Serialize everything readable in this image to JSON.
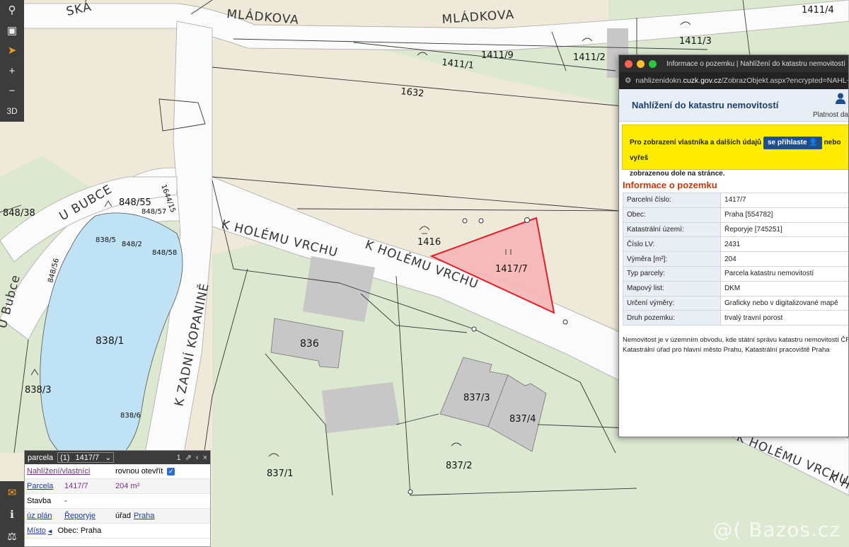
{
  "toolbar": {
    "search_icon": "magnifier",
    "map_icon": "map-fold",
    "locate_icon": "navigation-arrow",
    "zoom_in": "+",
    "zoom_out": "−",
    "view_3d": "3D"
  },
  "bottom_tools": {
    "comment_icon": "speech-bubble",
    "info_icon": "info-i",
    "ruler_icon": "ruler-marker"
  },
  "map": {
    "streets": {
      "mladkova_left": "MLÁDKOVA",
      "mladkova_right": "MLÁDKOVA",
      "u_bubce_top": "U BUBCE",
      "u_bubce_left": "U Bubce",
      "k_holemu_left": "K HOLÉMU VRCHU",
      "k_holemu_mid": "K HOLÉMU VRCHU",
      "k_holemu_bottom": "K HOLÉMU VRCHU",
      "k_ho_edge": "K Ho",
      "k_zadni": "K ZADNÍ KOPANINĚ",
      "s_edge": "SKÁ"
    },
    "parcels": {
      "p1411_4": "1411/4",
      "p1411_3": "1411/3",
      "p1411_9": "1411/9",
      "p1411_2": "1411/2",
      "p1411_1": "1411/1",
      "p1632": "1632",
      "p848_38": "848/38",
      "p848_55": "848/55",
      "p848_57": "848/57",
      "p1644_15": "1644/15",
      "p838_5": "838/5",
      "p848_2": "848/2",
      "p848_58": "848/58",
      "p848_56": "848/56",
      "p838_1": "838/1",
      "p838_3": "838/3",
      "p838_6": "838/6",
      "p1416": "1416",
      "p1417_7": "1417/7",
      "p836": "836",
      "p837_3": "837/3",
      "p837_4": "837/4",
      "p837_2": "837/2",
      "p837_1": "837/1"
    },
    "colors": {
      "road": "#fbfbfb",
      "land": "#efe9d9",
      "green": "#dce8d0",
      "water": "#bfe2f4",
      "building": "#c7c7c7",
      "selected_fill": "#f5b5b5",
      "selected_stroke": "#e0202a"
    }
  },
  "parcel_panel": {
    "title": "parcela",
    "index": "(1)",
    "selected": "1417/7",
    "count": "1",
    "rows": {
      "r1_label": "Nahlížení/vlastníci",
      "r1_value": "rovnou otevřít",
      "r2_label": "Parcela",
      "r2_number": "1417/7",
      "r2_area": "204 m²",
      "r3_label": "Stavba",
      "r3_value": "-",
      "r4_label": "úz plán",
      "r4_value": "Řeporyje",
      "r4_office": "úřad",
      "r4_office_link": "Praha",
      "r5_label": "Místo",
      "r5_arrow": "◂",
      "r5_value": "Obec: Praha"
    }
  },
  "popup": {
    "window_title": "Informace o pozemku | Nahlížení do katastru nemovitostí",
    "url_prefix": "nahlizenidokn.",
    "url_domain": "cuzk.gov.cz",
    "url_rest": "/ZobrazObjekt.aspx?encrypted=NAHL~s",
    "site_title": "Nahlížení do katastru nemovitostí",
    "platnost": "Platnost da",
    "banner_text1": "Pro zobrazení vlastníka a dalších údajů",
    "login_button": "se přihlaste",
    "banner_text2": "nebo vyřeš",
    "banner_text3": "zobrazenou dole na stránce.",
    "section_title": "Informace o pozemku",
    "rows": [
      {
        "k": "Parcelní číslo:",
        "v": "1417/7"
      },
      {
        "k": "Obec:",
        "v": "Praha [554782]"
      },
      {
        "k": "Katastrální území:",
        "v": "Řeporyje [745251]"
      },
      {
        "k": "Číslo LV:",
        "v": "2431"
      },
      {
        "k": "Výměra [m²]:",
        "v": "204"
      },
      {
        "k": "Typ parcely:",
        "v": "Parcela katastru nemovitostí"
      },
      {
        "k": "Mapový list:",
        "v": "DKM"
      },
      {
        "k": "Určení výměry:",
        "v": "Graficky nebo v digitalizované mapě"
      },
      {
        "k": "Druh pozemku:",
        "v": "trvalý travní porost"
      }
    ],
    "note_line1": "Nemovitost je v územním obvodu, kde státní správu katastru nemovitostí ČR",
    "note_line2": "Katastrální úřad pro hlavní město Prahu, Katastrální pracoviště Praha"
  },
  "watermark": "@( Bazos.cz"
}
